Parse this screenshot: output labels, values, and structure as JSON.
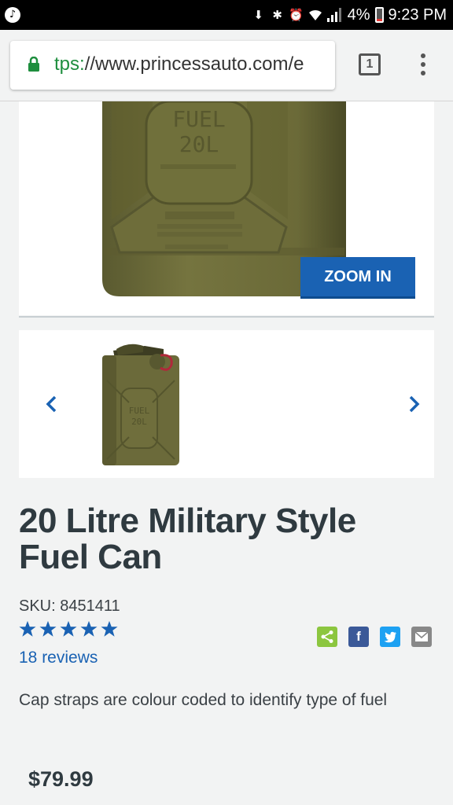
{
  "status_bar": {
    "battery_percent": "4%",
    "time": "9:23 PM",
    "icons": [
      "music-icon",
      "download-icon",
      "bluetooth-icon",
      "alarm-icon",
      "wifi-icon",
      "signal-icon",
      "battery-icon"
    ]
  },
  "browser": {
    "url_scheme": "tps:",
    "url_rest": "//www.princessauto.com/e",
    "tab_count": "1"
  },
  "product": {
    "zoom_label": "ZOOM IN",
    "can_embossed_text": "FUEL 20L",
    "title": "20 Litre Military Style Fuel Can",
    "sku": "SKU: 8451411",
    "rating": 5,
    "rating_max": 5,
    "reviews": "18 reviews",
    "description": "Cap straps are colour coded to identify type of fuel",
    "price": "$79.99"
  },
  "share": {
    "buttons": [
      "share-icon",
      "facebook-icon",
      "twitter-icon",
      "email-icon"
    ],
    "colors": {
      "share": "#8cc63f",
      "facebook": "#3b5998",
      "twitter": "#1da1f2",
      "email": "#888888"
    }
  },
  "colors": {
    "accent": "#1a62b3",
    "can_olive": "#6b6a3a",
    "title": "#2f3a40"
  }
}
